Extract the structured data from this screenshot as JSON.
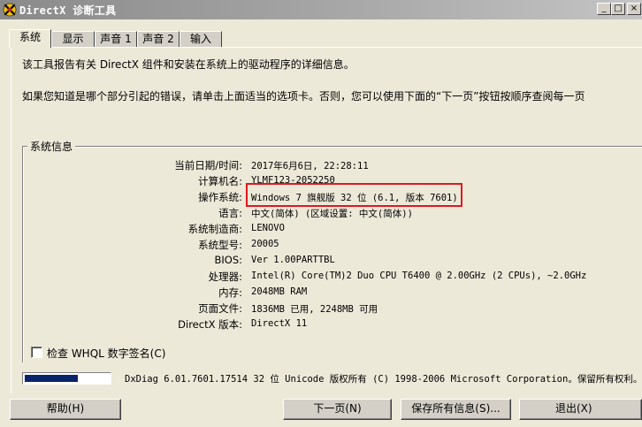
{
  "window": {
    "title": "DirectX 诊断工具",
    "minimize_glyph": "_",
    "maximize_glyph": "□",
    "close_glyph": "×"
  },
  "tabs": [
    {
      "label": "系统",
      "active": true
    },
    {
      "label": "显示",
      "active": false
    },
    {
      "label": "声音 1",
      "active": false
    },
    {
      "label": "声音 2",
      "active": false
    },
    {
      "label": "输入",
      "active": false
    }
  ],
  "intro": {
    "line1": "该工具报告有关 DirectX 组件和安装在系统上的驱动程序的详细信息。",
    "line2": "如果您知道是哪个部分引起的错误，请单击上面适当的选项卡。否则，您可以使用下面的“下一页”按钮按顺序查阅每一页"
  },
  "system_info": {
    "title": "系统信息",
    "rows": [
      {
        "label": "当前日期/时间:",
        "value": "2017年6月6日, 22:28:11"
      },
      {
        "label": "计算机名:",
        "value": "YLMF123-2052250"
      },
      {
        "label": "操作系统:",
        "value": "Windows 7 旗舰版 32 位 (6.1, 版本 7601)"
      },
      {
        "label": "语言:",
        "value": "中文(简体) (区域设置: 中文(简体))"
      },
      {
        "label": "系统制造商:",
        "value": "LENOVO"
      },
      {
        "label": "系统型号:",
        "value": "20005"
      },
      {
        "label": "BIOS:",
        "value": "Ver 1.00PARTTBL"
      },
      {
        "label": "处理器:",
        "value": "Intel(R) Core(TM)2 Duo CPU     T6400  @ 2.00GHz (2 CPUs), ~2.0GHz"
      },
      {
        "label": "内存:",
        "value": "2048MB RAM"
      },
      {
        "label": "页面文件:",
        "value": "1836MB 已用, 2248MB 可用"
      },
      {
        "label": "DirectX 版本:",
        "value": "DirectX 11"
      }
    ],
    "highlight_color": "#e0171f"
  },
  "whql": {
    "label": "检查 WHQL 数字签名(C)",
    "checked": false
  },
  "footer": {
    "progress_fraction": 0.63,
    "copyright": "DxDiag 6.01.7601.17514 32 位 Unicode 版权所有 (C) 1998-2006 Microsoft Corporation。保留所有权利。"
  },
  "buttons": {
    "help": "帮助(H)",
    "next": "下一页(N)",
    "save": "保存所有信息(S)...",
    "exit": "退出(X)"
  },
  "colors": {
    "title_bar": "#a0a0a0",
    "face": "#ece9d8",
    "progress": "#0a246a"
  }
}
